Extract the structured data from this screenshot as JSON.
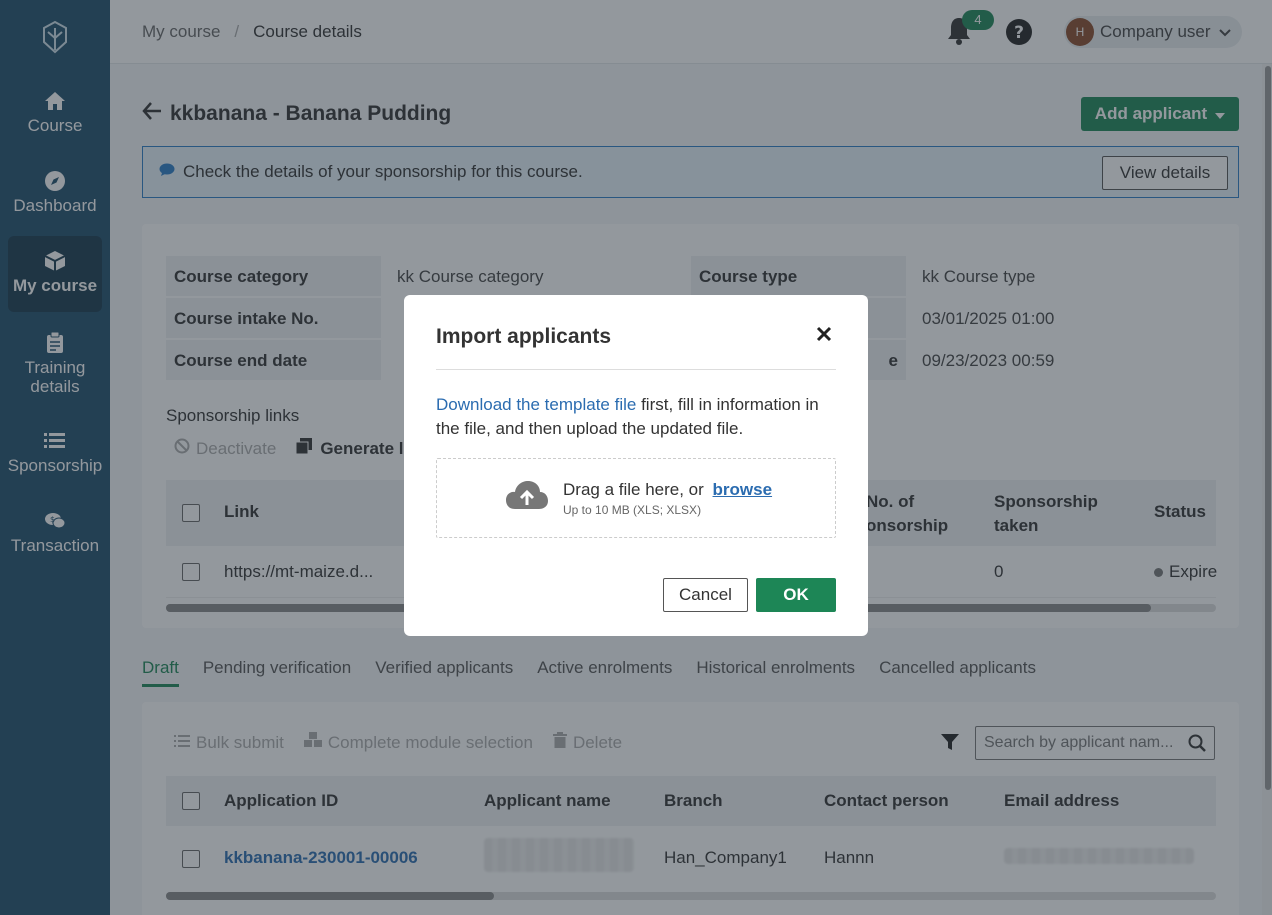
{
  "sidebar": {
    "items": [
      {
        "label": "Course",
        "icon": "home-icon"
      },
      {
        "label": "Dashboard",
        "icon": "compass-icon"
      },
      {
        "label": "My course",
        "icon": "box-icon",
        "active": true
      },
      {
        "label": "Training details",
        "icon": "clipboard-icon"
      },
      {
        "label": "Sponsorship",
        "icon": "list-icon"
      },
      {
        "label": "Transaction",
        "icon": "chat-dollar-icon"
      }
    ]
  },
  "topbar": {
    "breadcrumb": [
      "My course",
      "Course details"
    ],
    "separator": "/",
    "notification_count": "4",
    "user_initial": "H",
    "user_name": "Company user"
  },
  "page": {
    "title": "kkbanana - Banana Pudding",
    "add_applicant_label": "Add applicant",
    "info_message": "Check the details of your sponsorship for this course.",
    "view_details_label": "View details"
  },
  "details": [
    {
      "label": "Course category",
      "value": "kk Course category",
      "label2": "Course type",
      "value2": "kk Course type"
    },
    {
      "label": "Course intake No.",
      "value": "",
      "label2": "",
      "value2": "03/01/2025 01:00"
    },
    {
      "label": "Course end date",
      "value": "",
      "label2": "e",
      "value2": "09/23/2023 00:59"
    }
  ],
  "sponsorship": {
    "heading": "Sponsorship links",
    "deactivate_label": "Deactivate",
    "generate_label": "Generate l",
    "columns": [
      "Link",
      "No. of\nonsorship",
      "Sponsorship\ntaken",
      "Status"
    ],
    "row": {
      "link": "https://mt-maize.d...",
      "taken": "0",
      "status": "Expire"
    }
  },
  "tabs": [
    "Draft",
    "Pending verification",
    "Verified applicants",
    "Active enrolments",
    "Historical enrolments",
    "Cancelled applicants"
  ],
  "draft": {
    "bulk_submit_label": "Bulk submit",
    "complete_module_label": "Complete module selection",
    "delete_label": "Delete",
    "search_placeholder": "Search by applicant nam...",
    "columns": [
      "Application ID",
      "Applicant name",
      "Branch",
      "Contact person",
      "Email address"
    ],
    "row": {
      "id": "kkbanana-230001-00006",
      "branch": "Han_Company1",
      "contact": "Hannn"
    }
  },
  "modal": {
    "title": "Import applicants",
    "link_text": "Download the template file",
    "desc_rest": " first, fill in information in the file, and then upload the updated file.",
    "drop_text": "Drag a file here, or",
    "browse_label": "browse",
    "hint": "Up to 10 MB (XLS; XLSX)",
    "cancel_label": "Cancel",
    "ok_label": "OK"
  },
  "colors": {
    "primary": "#1d8656",
    "sidebar": "#1f4e6b",
    "link": "#2b6cb0"
  }
}
